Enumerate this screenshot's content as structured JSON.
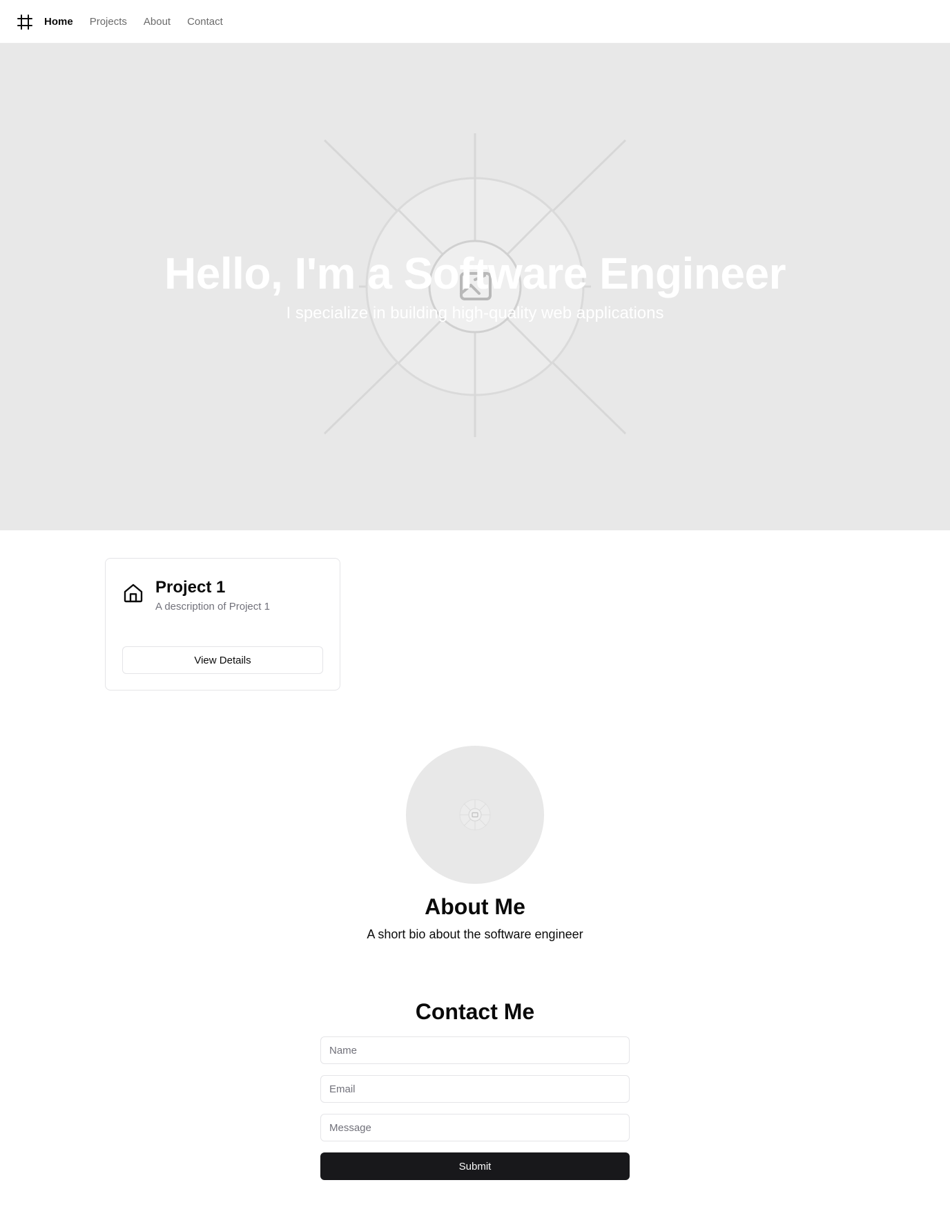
{
  "nav": {
    "logo_icon": "hash-frame-icon",
    "links": [
      {
        "label": "Home",
        "active": true
      },
      {
        "label": "Projects",
        "active": false
      },
      {
        "label": "About",
        "active": false
      },
      {
        "label": "Contact",
        "active": false
      }
    ]
  },
  "hero": {
    "title": "Hello, I'm a Software Engineer",
    "subtitle": "I specialize in building high-quality web applications",
    "background_icon": "image-placeholder-icon",
    "background_color": "#e8e8e8"
  },
  "projects": [
    {
      "icon": "home-icon",
      "title": "Project 1",
      "description": "A description of Project 1",
      "button_label": "View Details"
    }
  ],
  "about": {
    "avatar_icon": "image-placeholder-icon",
    "title": "About Me",
    "text": "A short bio about the software engineer"
  },
  "contact": {
    "title": "Contact Me",
    "name_placeholder": "Name",
    "email_placeholder": "Email",
    "message_placeholder": "Message",
    "submit_label": "Submit"
  },
  "colors": {
    "primary_button": "#18181b",
    "muted_text": "#71717a",
    "border": "#e4e4e7"
  }
}
